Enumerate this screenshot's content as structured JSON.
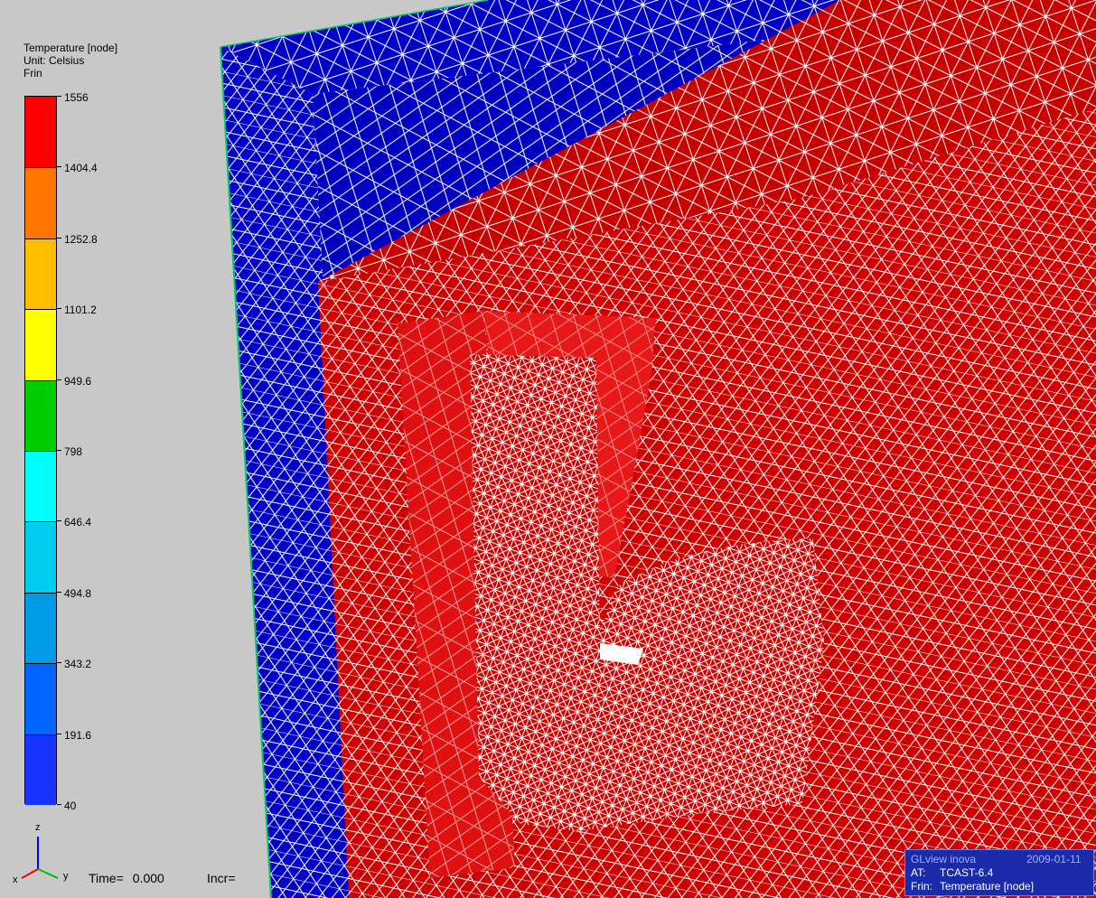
{
  "legend": {
    "title": "Temperature [node]",
    "unit": "Unit: Celsius",
    "set": "Frin",
    "labels": [
      "1556",
      "1404.4",
      "1252.8",
      "1101.2",
      "949.6",
      "798",
      "646.4",
      "494.8",
      "343.2",
      "191.6",
      "40"
    ],
    "band_colors": [
      "#ff0000",
      "#ff7700",
      "#ffbf00",
      "#ffff00",
      "#00cc00",
      "#00ffff",
      "#00ccee",
      "#009be6",
      "#0066ff",
      "#1a34ff"
    ],
    "base_color": "#0000ff"
  },
  "status": {
    "time_label": "Time=",
    "time_value": "0.000",
    "incr_label": "Incr="
  },
  "info_panel": {
    "row1_left": "GLview inova",
    "row1_right": "2009-01-11",
    "at_label": "AT:",
    "at_value": "TCAST-6.4",
    "frin_label": "Frin:",
    "frin_value": "Temperature [node]"
  },
  "axes": {
    "x": "x",
    "y": "y",
    "z": "z"
  },
  "colors": {
    "mould": "#0000c8",
    "mould_edge": "#00cc66",
    "casting": "#d00000",
    "casting_top": "#c80000",
    "casting_side": "#b00000",
    "mesh": "#ffffff",
    "background": "#c8c8c8"
  }
}
